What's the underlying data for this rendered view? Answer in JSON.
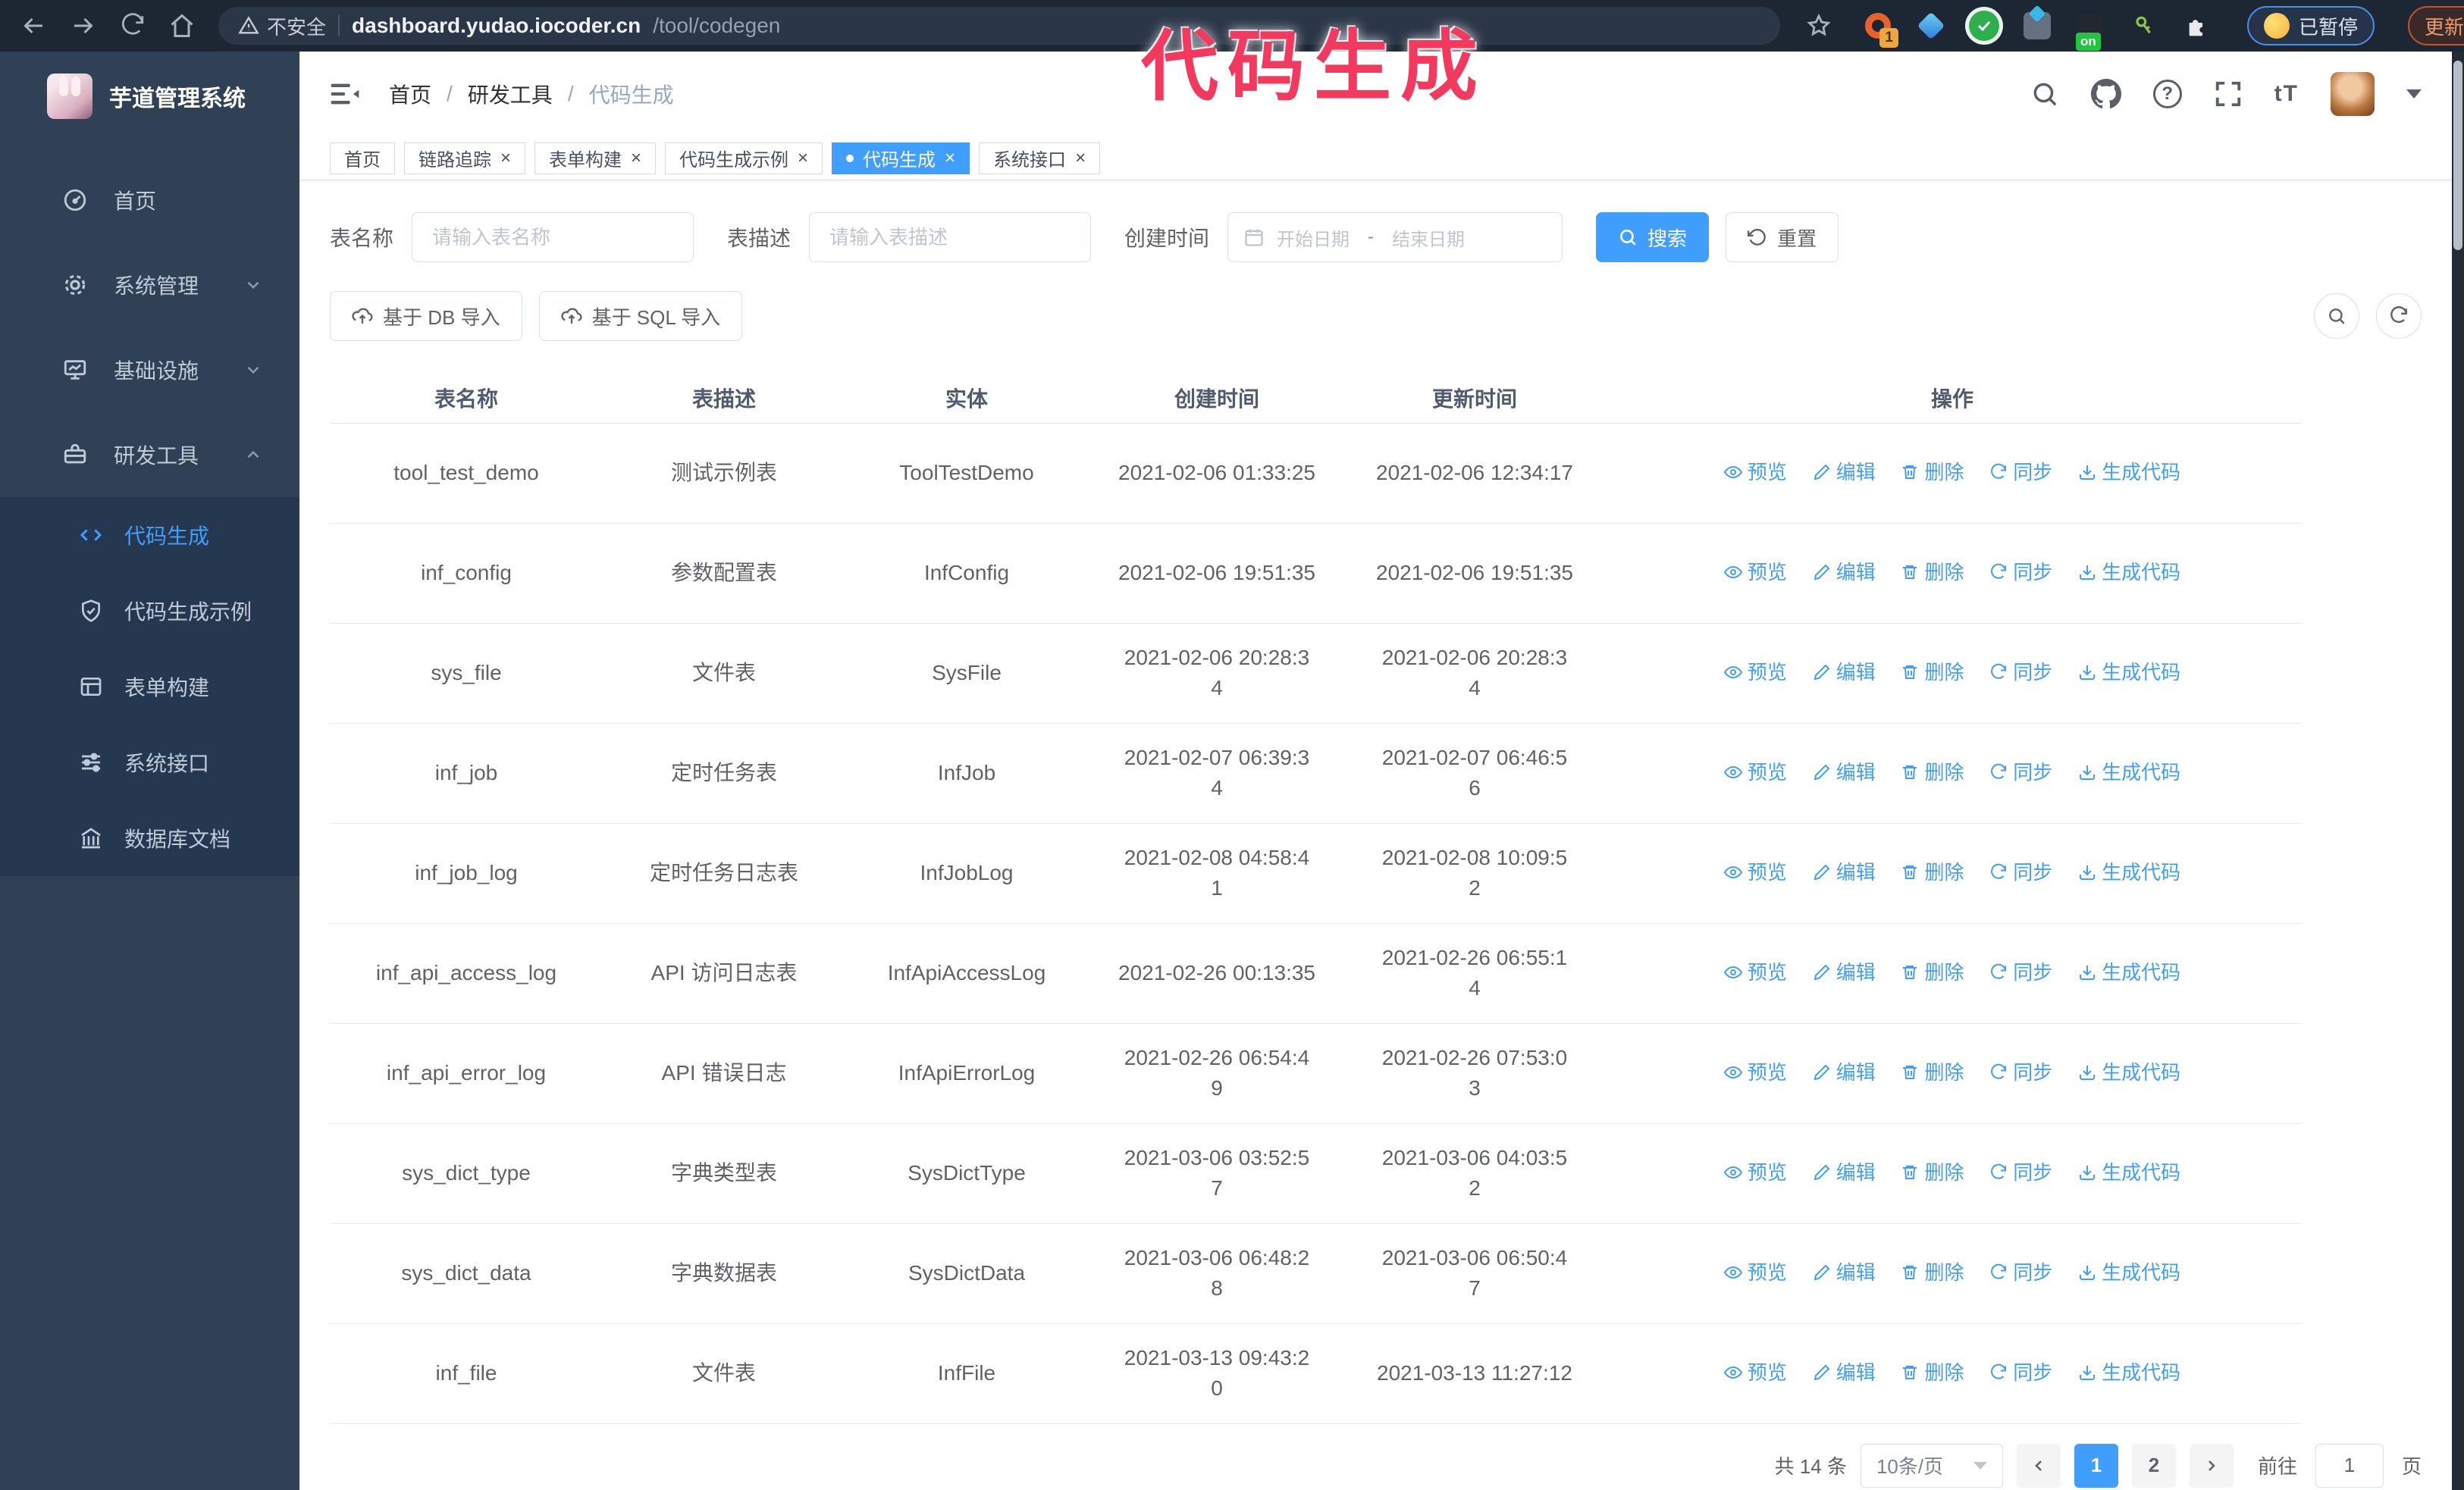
{
  "theme": {
    "accent": "#409eff",
    "annotation_color": "#f4395f",
    "sidebar_bg": "#304156",
    "submenu_bg": "#263850"
  },
  "annotation": {
    "text": "代码生成"
  },
  "browser": {
    "security_label": "不安全",
    "url_host": "dashboard.yudao.iocoder.cn",
    "url_path": "/tool/codegen",
    "extension_badge": "1",
    "extension_on_label": "on",
    "profile_status": "已暂停",
    "update_label": "更新"
  },
  "sidebar": {
    "title": "芋道管理系统",
    "items": [
      {
        "label": "首页"
      },
      {
        "label": "系统管理"
      },
      {
        "label": "基础设施"
      },
      {
        "label": "研发工具"
      }
    ],
    "submenu": [
      {
        "label": "代码生成"
      },
      {
        "label": "代码生成示例"
      },
      {
        "label": "表单构建"
      },
      {
        "label": "系统接口"
      },
      {
        "label": "数据库文档"
      }
    ]
  },
  "header": {
    "breadcrumb": [
      "首页",
      "研发工具",
      "代码生成"
    ]
  },
  "ui": {
    "slash": "/",
    "close_glyph": "×",
    "question_glyph": "?",
    "text_size_glyph": "tT"
  },
  "tabs": [
    {
      "label": "首页"
    },
    {
      "label": "链路追踪"
    },
    {
      "label": "表单构建"
    },
    {
      "label": "代码生成示例"
    },
    {
      "label": "代码生成"
    },
    {
      "label": "系统接口"
    }
  ],
  "filters": {
    "name_label": "表名称",
    "name_placeholder": "请输入表名称",
    "desc_label": "表描述",
    "desc_placeholder": "请输入表描述",
    "time_label": "创建时间",
    "start_placeholder": "开始日期",
    "range_separator": "-",
    "end_placeholder": "结束日期",
    "search_label": "搜索",
    "reset_label": "重置"
  },
  "toolbar": {
    "import_db": "基于 DB 导入",
    "import_sql": "基于 SQL 导入"
  },
  "table": {
    "columns": [
      "表名称",
      "表描述",
      "实体",
      "创建时间",
      "更新时间",
      "操作"
    ],
    "row_actions": [
      "预览",
      "编辑",
      "删除",
      "同步",
      "生成代码"
    ],
    "rows": [
      {
        "name": "tool_test_demo",
        "desc": "测试示例表",
        "entity": "ToolTestDemo",
        "created": "2021-02-06 01:33:25",
        "updated": "2021-02-06 12:34:17"
      },
      {
        "name": "inf_config",
        "desc": "参数配置表",
        "entity": "InfConfig",
        "created": "2021-02-06 19:51:35",
        "updated": "2021-02-06 19:51:35"
      },
      {
        "name": "sys_file",
        "desc": "文件表",
        "entity": "SysFile",
        "created": "2021-02-06 20:28:3\n4",
        "updated": "2021-02-06 20:28:3\n4"
      },
      {
        "name": "inf_job",
        "desc": "定时任务表",
        "entity": "InfJob",
        "created": "2021-02-07 06:39:3\n4",
        "updated": "2021-02-07 06:46:5\n6"
      },
      {
        "name": "inf_job_log",
        "desc": "定时任务日志表",
        "entity": "InfJobLog",
        "created": "2021-02-08 04:58:4\n1",
        "updated": "2021-02-08 10:09:5\n2"
      },
      {
        "name": "inf_api_access_log",
        "desc": "API 访问日志表",
        "entity": "InfApiAccessLog",
        "created": "2021-02-26 00:13:35",
        "updated": "2021-02-26 06:55:1\n4"
      },
      {
        "name": "inf_api_error_log",
        "desc": "API 错误日志",
        "entity": "InfApiErrorLog",
        "created": "2021-02-26 06:54:4\n9",
        "updated": "2021-02-26 07:53:0\n3"
      },
      {
        "name": "sys_dict_type",
        "desc": "字典类型表",
        "entity": "SysDictType",
        "created": "2021-03-06 03:52:5\n7",
        "updated": "2021-03-06 04:03:5\n2"
      },
      {
        "name": "sys_dict_data",
        "desc": "字典数据表",
        "entity": "SysDictData",
        "created": "2021-03-06 06:48:2\n8",
        "updated": "2021-03-06 06:50:4\n7"
      },
      {
        "name": "inf_file",
        "desc": "文件表",
        "entity": "InfFile",
        "created": "2021-03-13 09:43:2\n0",
        "updated": "2021-03-13 11:27:12"
      }
    ]
  },
  "pagination": {
    "total": "共 14 条",
    "page_size": "10条/页",
    "page_1": "1",
    "page_2": "2",
    "goto_label": "前往",
    "goto_value": "1",
    "goto_suffix": "页"
  }
}
